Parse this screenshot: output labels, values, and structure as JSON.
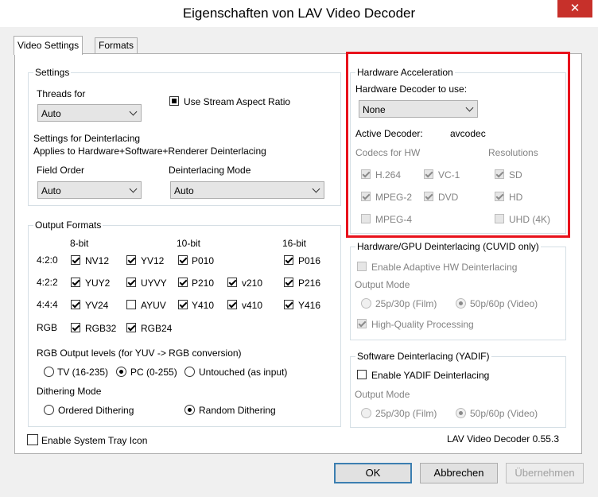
{
  "window": {
    "title": "Eigenschaften von LAV Video Decoder",
    "close_glyph": "✕"
  },
  "tabs": [
    "Video Settings",
    "Formats"
  ],
  "settings": {
    "group": "Settings",
    "threads_label": "Threads for",
    "threads_value": "Auto",
    "aspect_label": "Use Stream Aspect Ratio",
    "deint_line1": "Settings for Deinterlacing",
    "deint_line2": "Applies to Hardware+Software+Renderer Deinterlacing",
    "field_order_label": "Field Order",
    "field_order_value": "Auto",
    "deint_mode_label": "Deinterlacing Mode",
    "deint_mode_value": "Auto"
  },
  "output": {
    "group": "Output Formats",
    "col_8": "8-bit",
    "col_10": "10-bit",
    "col_16": "16-bit",
    "row_420": "4:2:0",
    "row_422": "4:2:2",
    "row_444": "4:4:4",
    "row_rgb": "RGB",
    "nv12": "NV12",
    "yv12": "YV12",
    "p010": "P010",
    "p016": "P016",
    "yuy2": "YUY2",
    "uyvy": "UYVY",
    "p210": "P210",
    "v210": "v210",
    "p216": "P216",
    "yv24": "YV24",
    "ayuv": "AYUV",
    "y410": "Y410",
    "v410": "v410",
    "y416": "Y416",
    "rgb32": "RGB32",
    "rgb24": "RGB24",
    "levels_label": "RGB Output levels (for YUV -> RGB conversion)",
    "tv": "TV (16-235)",
    "pc": "PC (0-255)",
    "untouched": "Untouched (as input)",
    "dither_label": "Dithering Mode",
    "ordered": "Ordered Dithering",
    "random": "Random Dithering"
  },
  "hw": {
    "group": "Hardware Acceleration",
    "decoder_label": "Hardware Decoder to use:",
    "decoder_value": "None",
    "active_label": "Active Decoder:",
    "active_value": "avcodec",
    "codecs_label": "Codecs for HW",
    "resolutions_label": "Resolutions",
    "h264": "H.264",
    "vc1": "VC-1",
    "sd": "SD",
    "mpeg2": "MPEG-2",
    "dvd": "DVD",
    "hd": "HD",
    "mpeg4": "MPEG-4",
    "uhd": "UHD (4K)",
    "highlight_color": "#e8121c"
  },
  "gpu": {
    "group": "Hardware/GPU Deinterlacing (CUVID only)",
    "adaptive": "Enable Adaptive HW Deinterlacing",
    "output_mode": "Output Mode",
    "film": "25p/30p (Film)",
    "video": "50p/60p (Video)",
    "hq": "High-Quality Processing"
  },
  "sw": {
    "group": "Software Deinterlacing (YADIF)",
    "yadif": "Enable YADIF Deinterlacing",
    "output_mode": "Output Mode",
    "film": "25p/30p (Film)",
    "video": "50p/60p (Video)"
  },
  "tray": "Enable System Tray Icon",
  "version": "LAV Video Decoder 0.55.3",
  "buttons": {
    "ok": "OK",
    "cancel": "Abbrechen",
    "apply": "Übernehmen"
  }
}
